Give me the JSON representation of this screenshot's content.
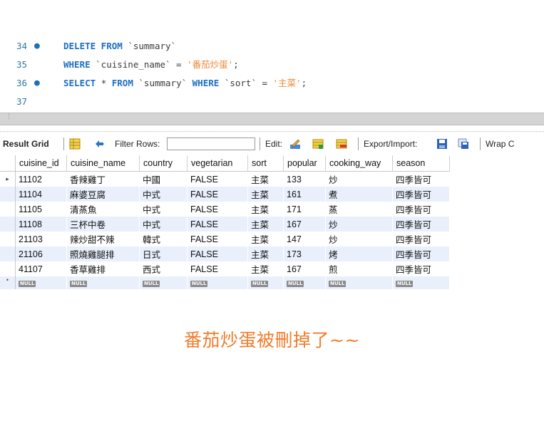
{
  "editor": {
    "lines": [
      {
        "num": "34",
        "marker": "●",
        "parts": [
          [
            "kw",
            "DELETE FROM "
          ],
          [
            "id",
            "`summary`"
          ]
        ]
      },
      {
        "num": "35",
        "marker": "",
        "parts": [
          [
            "kw",
            "WHERE "
          ],
          [
            "id",
            "`cuisine_name`"
          ],
          [
            "op",
            " = "
          ],
          [
            "str",
            "'番茄炒蛋'"
          ],
          [
            "op",
            ";"
          ]
        ]
      },
      {
        "num": "36",
        "marker": "●",
        "parts": [
          [
            "kw",
            "SELECT "
          ],
          [
            "op",
            "* "
          ],
          [
            "kw",
            "FROM "
          ],
          [
            "id",
            "`summary` "
          ],
          [
            "kw",
            "WHERE "
          ],
          [
            "id",
            "`sort`"
          ],
          [
            "op",
            " = "
          ],
          [
            "str",
            "'主菜'"
          ],
          [
            "op",
            ";"
          ]
        ]
      },
      {
        "num": "37",
        "marker": "",
        "parts": []
      }
    ]
  },
  "toolbar": {
    "result_grid_label": "Result Grid",
    "filter_rows_label": "Filter Rows:",
    "filter_value": "",
    "edit_label": "Edit:",
    "export_import_label": "Export/Import:",
    "wrap_label": "Wrap C"
  },
  "grid": {
    "columns": [
      "cuisine_id",
      "cuisine_name",
      "country",
      "vegetarian",
      "sort",
      "popular",
      "cooking_way",
      "season"
    ],
    "rows": [
      [
        "11102",
        "香辣雞丁",
        "中國",
        "FALSE",
        "主菜",
        "133",
        "炒",
        "四季皆可"
      ],
      [
        "11104",
        "麻婆豆腐",
        "中式",
        "FALSE",
        "主菜",
        "161",
        "煮",
        "四季皆可"
      ],
      [
        "11105",
        "清蒸魚",
        "中式",
        "FALSE",
        "主菜",
        "171",
        "蒸",
        "四季皆可"
      ],
      [
        "11108",
        "三杯中卷",
        "中式",
        "FALSE",
        "主菜",
        "167",
        "炒",
        "四季皆可"
      ],
      [
        "21103",
        "辣炒甜不辣",
        "韓式",
        "FALSE",
        "主菜",
        "147",
        "炒",
        "四季皆可"
      ],
      [
        "21106",
        "照燒雞腿排",
        "日式",
        "FALSE",
        "主菜",
        "173",
        "烤",
        "四季皆可"
      ],
      [
        "41107",
        "香草雞排",
        "西式",
        "FALSE",
        "主菜",
        "167",
        "煎",
        "四季皆可"
      ]
    ],
    "null_label": "NULL",
    "row_marker": "▸",
    "new_row_marker": "•"
  },
  "caption": "番茄炒蛋被刪掉了~~"
}
